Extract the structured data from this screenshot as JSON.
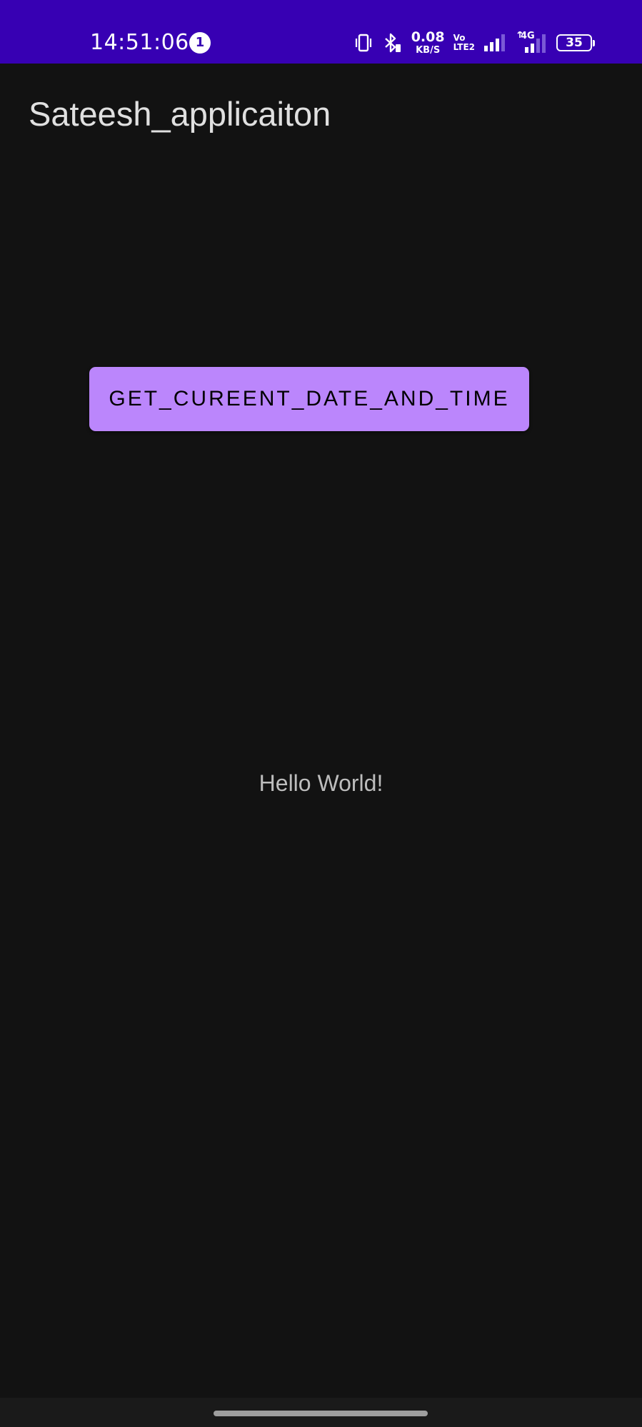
{
  "status_bar": {
    "time": "14:51:06",
    "notification_count": "1",
    "net_speed_value": "0.08",
    "net_speed_unit": "KB/S",
    "volte_top": "Vo",
    "volte_bottom": "LTE2",
    "network_type": "4G",
    "battery_level": "35",
    "background_color": "#3700B3"
  },
  "action_bar": {
    "title": "Sateesh_applicaiton"
  },
  "main": {
    "button_label": "GET_CUREENT_DATE_AND_TIME",
    "button_color": "#BB86FC",
    "text_view": "Hello World!"
  }
}
